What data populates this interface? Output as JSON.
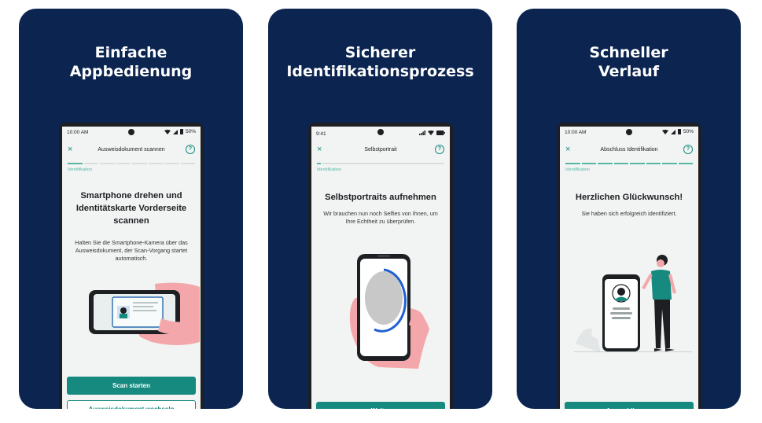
{
  "colors": {
    "card_bg": "#0b2450",
    "accent": "#178a80",
    "progress_on": "#59b6a3",
    "screen_bg": "#f1f4f3"
  },
  "cards": [
    {
      "title_line1": "Einfache",
      "title_line2": "Appbedienung",
      "status_time": "10:00 AM",
      "battery": "50%",
      "appbar_title": "Ausweisdokument scannen",
      "close_icon": "×",
      "help_icon": "?",
      "step_label": "Identifikation",
      "heading": "Smartphone drehen und Identitätskarte Vorderseite scannen",
      "body": "Halten Sie die Smartphone-Kamera über das Ausweisdokument, der Scan-Vorgang startet automatisch.",
      "primary_button": "Scan starten",
      "secondary_button": "Ausweisdokument wechseln",
      "illustration": "hand-holding-phone-scanning-id-card"
    },
    {
      "title_line1": "Sicherer",
      "title_line2": "Identifikationsprozess",
      "status_time": "9:41",
      "battery": "",
      "appbar_title": "Selbstportrait",
      "close_icon": "×",
      "help_icon": "?",
      "step_label": "Identifikation",
      "heading": "Selbstportraits aufnehmen",
      "body": "Wir brauchen nun noch Selfies von Ihnen, um Ihre Echtheit zu überprüfen.",
      "primary_button": "Weiter",
      "illustration": "hand-holding-phone-selfie-frame"
    },
    {
      "title_line1": "Schneller",
      "title_line2": "Verlauf",
      "status_time": "10:00 AM",
      "battery": "50%",
      "appbar_title": "Abschluss Identifikation",
      "close_icon": "×",
      "help_icon": "?",
      "step_label": "Identifikation",
      "heading": "Herzlichen Glückwunsch!",
      "body": "Sie haben sich erfolgreich identifiziert.",
      "primary_button": "App schliessen",
      "illustration": "person-standing-next-to-phone-profile"
    }
  ]
}
